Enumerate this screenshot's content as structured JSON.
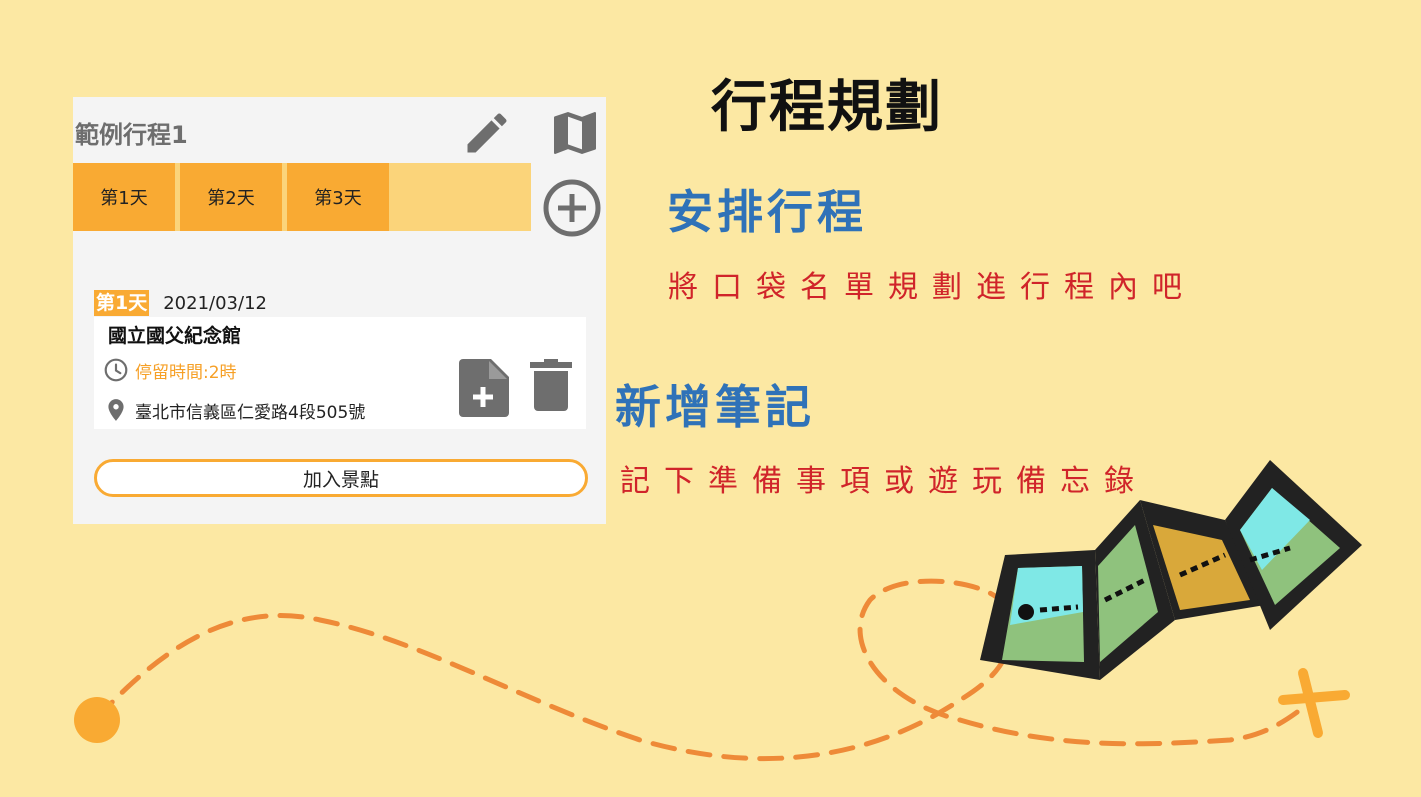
{
  "card": {
    "trip_title": "範例行程1",
    "day_tabs": [
      "第1天",
      "第2天",
      "第3天"
    ],
    "day_badge": "第1天",
    "date": "2021/03/12",
    "spot": {
      "name": "國立國父紀念館",
      "stay": "停留時間:2時",
      "address": "臺北市信義區仁愛路4段505號"
    },
    "add_spot_label": "加入景點"
  },
  "headings": {
    "main": "行程規劃",
    "section1_title": "安排行程",
    "section1_desc": "將口袋名單規劃進行程內吧",
    "section2_title": "新增筆記",
    "section2_desc": "記下準備事項或遊玩備忘錄"
  },
  "icons": {
    "edit": "pencil-icon",
    "map": "map-icon",
    "add_day": "plus-circle-icon",
    "clock": "clock-icon",
    "location": "map-pin-icon",
    "note": "note-add-icon",
    "delete": "trash-icon"
  },
  "colors": {
    "background": "#fce8a3",
    "accent_orange": "#f9aa33",
    "heading_blue": "#2f72b8",
    "desc_red": "#d0242a",
    "icon_gray": "#6e6e6e"
  }
}
